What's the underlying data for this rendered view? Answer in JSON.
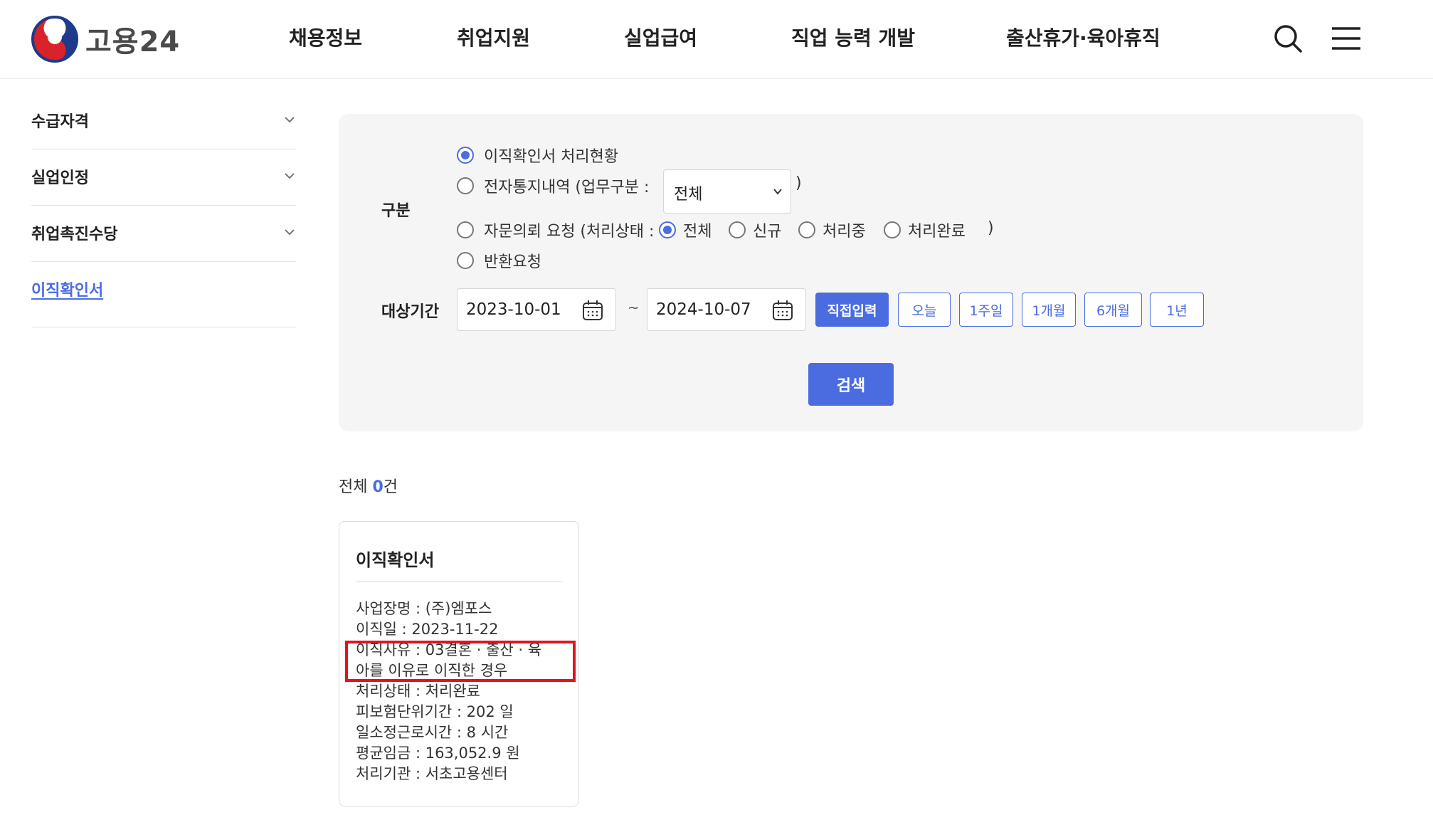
{
  "header": {
    "logo_text": "고용24",
    "nav": [
      "채용정보",
      "취업지원",
      "실업급여",
      "직업 능력 개발",
      "출산휴가·육아휴직"
    ],
    "icons": [
      "search-icon",
      "menu-icon"
    ]
  },
  "sidebar": {
    "items": [
      {
        "label": "수급자격",
        "expandable": true
      },
      {
        "label": "실업인정",
        "expandable": true
      },
      {
        "label": "취업촉진수당",
        "expandable": true
      },
      {
        "label": "이직확인서",
        "active": true
      }
    ]
  },
  "search": {
    "category_label": "구분",
    "options": {
      "processing_status": "이직확인서 처리현황",
      "notice_history": "전자통지내역 (업무구분 :",
      "advisory_request": "자문의뢰 요청 (처리상태 :",
      "return_request": "반환요청"
    },
    "selected_option": "이직확인서 처리현황",
    "business_type_select": {
      "value": "전체",
      "close_paren": ")"
    },
    "status_options": [
      "전체",
      "신규",
      "처리중",
      "처리완료"
    ],
    "status_selected": "전체",
    "status_close_paren": ")",
    "period_label": "대상기간",
    "start_date": "2023-10-01",
    "tilde": "~",
    "end_date": "2024-10-07",
    "period_buttons": [
      "직접입력",
      "오늘",
      "1주일",
      "1개월",
      "6개월",
      "1년"
    ],
    "period_selected": "직접입력",
    "search_button": "검색"
  },
  "results": {
    "total_prefix": "전체 ",
    "total_count": "0",
    "total_suffix": "건",
    "card": {
      "title": "이직확인서",
      "lines": [
        "사업장명 : (주)엠포스",
        "이직일 : 2023-11-22",
        "이직사유 : 03결혼 · 출산 · 육",
        "아를 이유로 이직한 경우",
        "처리상태 : 처리완료",
        "피보험단위기간 : 202 일",
        "일소정근로시간 : 8 시간",
        "평균임금 : 163,052.9 원",
        "처리기관 : 서초고용센터"
      ]
    }
  },
  "colors": {
    "accent": "#4a6ce0",
    "highlight": "#e0141e",
    "panel_bg": "#f5f5f5"
  }
}
